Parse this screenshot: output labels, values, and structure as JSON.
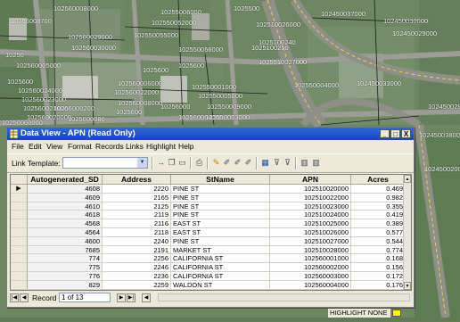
{
  "colors": {
    "highlight": "#ffff00",
    "titlebar": "#1f54c6"
  },
  "map": {
    "labels": [
      "102560008000",
      "10256008700",
      "102560029000",
      "102560030000",
      "10255006000",
      "102550052000",
      "102550055000",
      "102550056000",
      "1025500",
      "1025510027000",
      "102510026000",
      "1025100240",
      "1025100250",
      "102450037000",
      "102450030000",
      "102450029000",
      "102450033000",
      "102450028000",
      "1025600",
      "102560024000",
      "102560023000",
      "102560021000",
      "102560020000",
      "102560022000",
      "102560008000",
      "1025600",
      "102560004000",
      "102550001000",
      "102550005000",
      "10256000",
      "102550009000",
      "102560006000",
      "1025600",
      "102560005000",
      "102550003000",
      "102550004000",
      "102450038000",
      "102450020000",
      "10250",
      "1025600",
      "10256000200",
      "1025600080",
      "10250060000"
    ]
  },
  "window": {
    "title": "Data View - APN (Read Only)",
    "buttons": {
      "minimize": "_",
      "maximize": "□",
      "close": "X"
    },
    "menus": [
      "File",
      "Edit",
      "View",
      "Format",
      "Records",
      "Links",
      "Highlight",
      "Help"
    ],
    "toolbar": {
      "link_template_label": "Link Template:",
      "link_template_value": "",
      "icons": [
        "arrow-icon",
        "copy-icon",
        "paste-icon",
        "print-icon",
        "highlight-icon",
        "pencil-icon",
        "pencil-icon",
        "pencil-icon",
        "table-icon",
        "filter-icon",
        "filter-icon",
        "columns-icon",
        "columns-icon"
      ]
    },
    "grid": {
      "columns": [
        "Autogenerated_SD",
        "Address",
        "StName",
        "APN",
        "Acres"
      ],
      "rows": [
        [
          "4608",
          "2220",
          "PINE ST",
          "102510020000",
          "0.469"
        ],
        [
          "4609",
          "2165",
          "PINE ST",
          "102510022000",
          "0.982"
        ],
        [
          "4610",
          "2125",
          "PINE ST",
          "102510023000",
          "0.355"
        ],
        [
          "4618",
          "2119",
          "PINE ST",
          "102510024000",
          "0.419"
        ],
        [
          "4568",
          "2116",
          "EAST ST",
          "102510025000",
          "0.389"
        ],
        [
          "4564",
          "2118",
          "EAST ST",
          "102510026000",
          "0.577"
        ],
        [
          "4600",
          "2240",
          "PINE ST",
          "102510027000",
          "0.544"
        ],
        [
          "7685",
          "2191",
          "MARKET ST",
          "102510028000",
          "0.774"
        ],
        [
          "774",
          "2256",
          "CALIFORNIA ST",
          "102560001000",
          "0.168"
        ],
        [
          "775",
          "2246",
          "CALIFORNIA ST",
          "102560002000",
          "0.156"
        ],
        [
          "776",
          "2236",
          "CALIFORNIA ST",
          "102560003000",
          "0.172"
        ],
        [
          "829",
          "2259",
          "WALDON ST",
          "102560004000",
          "0.176"
        ],
        [
          "804",
          "2269",
          "WALDON ST",
          "102560005000",
          "0.161"
        ]
      ],
      "current_row_marker": "▶"
    },
    "nav": {
      "record_label": "Record",
      "position": "1 of 13"
    }
  },
  "status": {
    "text": "HIGHLIGHT  NONE"
  }
}
